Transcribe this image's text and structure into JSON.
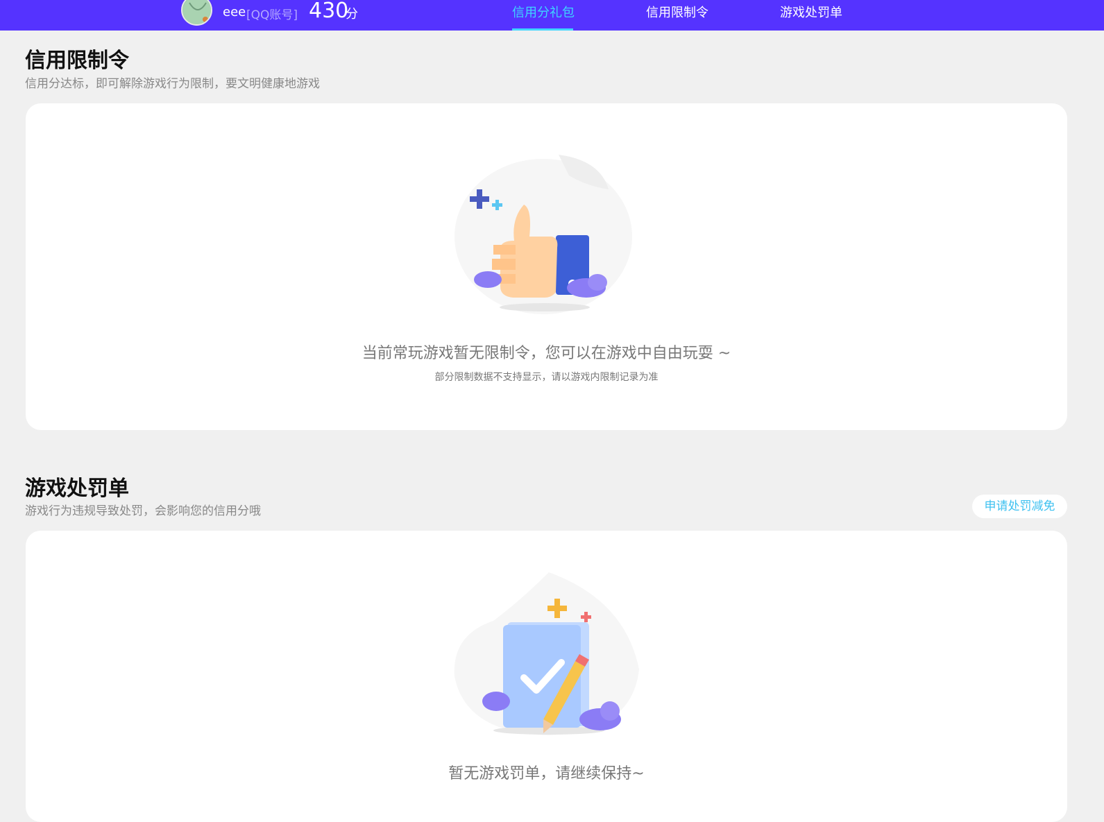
{
  "header": {
    "user_name": "eee",
    "account_type": "[QQ账号]",
    "score": "430",
    "score_unit": "分",
    "tabs": [
      {
        "label": "信用分礼包",
        "active": true
      },
      {
        "label": "信用限制令",
        "active": false
      },
      {
        "label": "游戏处罚单",
        "active": false
      }
    ]
  },
  "restriction": {
    "title": "信用限制令",
    "subtitle": "信用分达标，即可解除游戏行为限制，要文明健康地游戏",
    "empty_message": "当前常玩游戏暂无限制令，您可以在游戏中自由玩耍 ~",
    "empty_note": "部分限制数据不支持显示，请以游戏内限制记录为准",
    "illustration": "thumbs-up-icon"
  },
  "penalty": {
    "title": "游戏处罚单",
    "subtitle": "游戏行为违规导致处罚，会影响您的信用分哦",
    "appeal_button": "申请处罚减免",
    "empty_message": "暂无游戏罚单，请继续保持~",
    "illustration": "checklist-pencil-icon"
  },
  "colors": {
    "header_bg": "#5533ff",
    "active_tab": "#3ed6ff",
    "page_bg": "#f0f0f0",
    "appeal_text": "#3fc1f0"
  }
}
